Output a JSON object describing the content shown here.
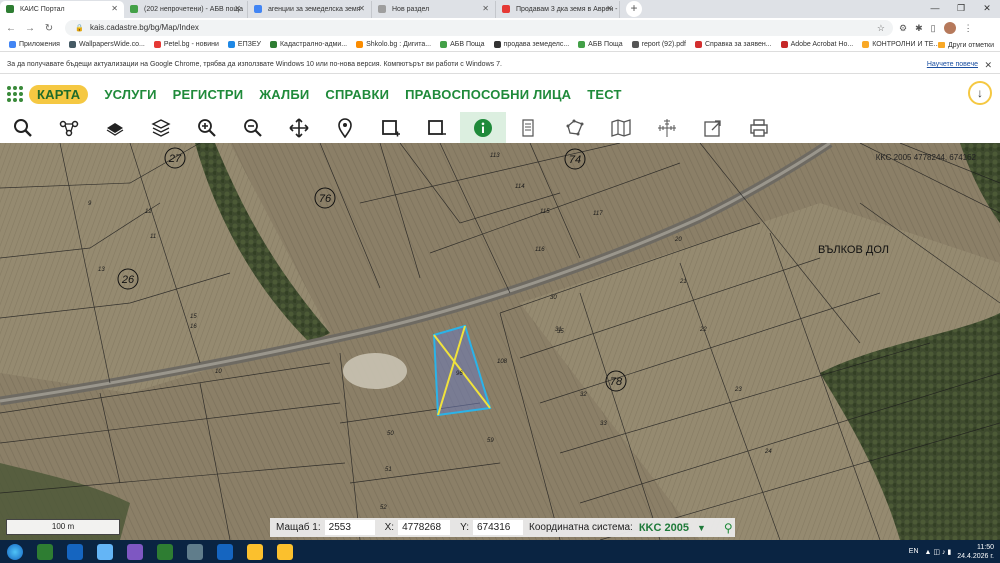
{
  "browser": {
    "tabs": [
      {
        "title": "КАИС Портал",
        "color": "#2e7d32",
        "active": true
      },
      {
        "title": "(202 непрочетени) - АБВ поща",
        "color": "#43a047",
        "active": false
      },
      {
        "title": "агенции за земеделска земя",
        "color": "#4285f4",
        "active": false
      },
      {
        "title": "Нов раздел",
        "color": "#9e9e9e",
        "active": false
      },
      {
        "title": "Продавам 3 дка земя в Аврен -",
        "color": "#e53935",
        "active": false
      }
    ],
    "url": "kais.cadastre.bg/bg/Map/Index",
    "bookmarks": [
      {
        "label": "Приложения",
        "color": "#4285f4"
      },
      {
        "label": "WallpapersWide.co...",
        "color": "#455a64"
      },
      {
        "label": "Petel.bg - новини",
        "color": "#e53935"
      },
      {
        "label": "ЕПЗЕУ",
        "color": "#1e88e5"
      },
      {
        "label": "Кадастрално-адми...",
        "color": "#2e7d32"
      },
      {
        "label": "Shkolo.bg : Дигита...",
        "color": "#fb8c00"
      },
      {
        "label": "АБВ Поща",
        "color": "#43a047"
      },
      {
        "label": "продава земеделс...",
        "color": "#333333"
      },
      {
        "label": "АБВ Поща",
        "color": "#43a047"
      },
      {
        "label": "report (92).pdf",
        "color": "#555555"
      },
      {
        "label": "Справка за заявен...",
        "color": "#d32f2f"
      },
      {
        "label": "Adobe Acrobat Ho...",
        "color": "#c62828"
      },
      {
        "label": "КОНТРОЛНИ И ТЕ...",
        "color": "#f9a825"
      }
    ],
    "other_bookmarks": "Други отметки"
  },
  "infobar": {
    "message": "За да получавате бъдещи актуализации на Google Chrome, трябва да използвате Windows 10 или по-нова версия. Компютърът ви работи с Windows 7.",
    "learn_more": "Научете повече"
  },
  "nav": {
    "items": [
      "КАРТА",
      "УСЛУГИ",
      "РЕГИСТРИ",
      "ЖАЛБИ",
      "СПРАВКИ",
      "ПРАВОСПОСОБНИ ЛИЦА",
      "ТЕСТ"
    ]
  },
  "toolbar": {
    "tools": [
      "search-icon",
      "route-icon",
      "layer-icon",
      "layers-icon",
      "zoom-in-icon",
      "zoom-out-icon",
      "pan-icon",
      "marker-icon",
      "rectangle-add-icon",
      "rectangle-remove-icon",
      "info-icon",
      "document-icon",
      "polygon-icon",
      "map-icon",
      "measure-icon",
      "export-icon",
      "print-icon"
    ],
    "active": "info-icon"
  },
  "map": {
    "coords": "КKC 2005 4778244, 674162",
    "place_name": "ВЪЛКОВ ДОЛ",
    "circle_labels": [
      {
        "text": "27"
      },
      {
        "text": "74"
      },
      {
        "text": "76"
      },
      {
        "text": "26"
      },
      {
        "text": "78"
      }
    ],
    "parcel_labels": [
      "113",
      "114",
      "115",
      "116",
      "117",
      "9",
      "12",
      "11",
      "13",
      "16",
      "15",
      "10",
      "20",
      "21",
      "22",
      "23",
      "24",
      "30",
      "31",
      "32",
      "33",
      "35",
      "50",
      "51",
      "52",
      "59",
      "108",
      "96"
    ]
  },
  "scale": {
    "label": "100 m"
  },
  "status": {
    "scale_label": "Мащаб 1:",
    "scale_value": "2553",
    "x_label": "X:",
    "x_value": "4778268",
    "y_label": "Y:",
    "y_value": "674316",
    "system_label": "Координатна система:",
    "system_value": "КKC 2005"
  },
  "taskbar": {
    "apps": [
      "#2e7d32",
      "#1565c0",
      "#64b5f6",
      "#7e57c2",
      "#2e7d32",
      "#607d8b",
      "#1565c0",
      "#fbc02d",
      "#fbc02d"
    ],
    "lang": "EN",
    "time": "11:50",
    "date": "24.4.2026 г."
  }
}
